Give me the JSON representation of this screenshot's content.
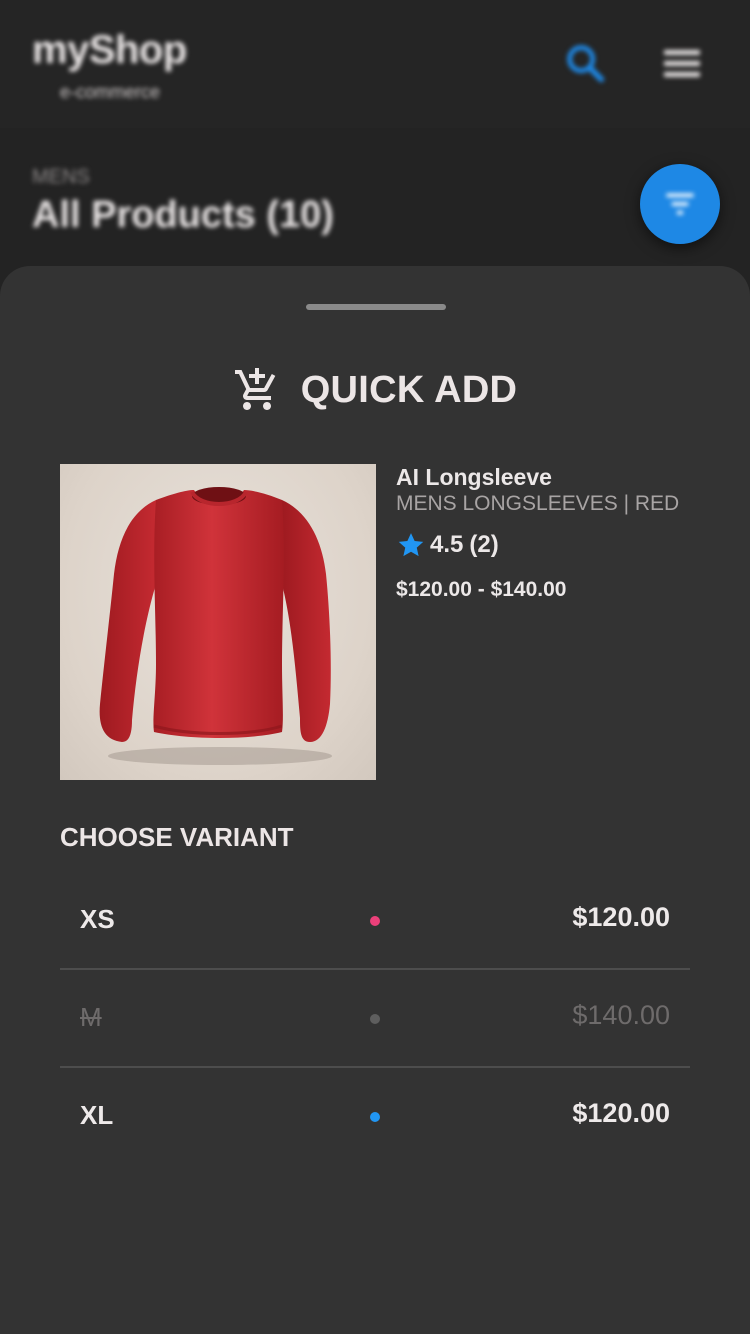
{
  "header": {
    "logo": "myShop",
    "logo_subtitle": "e-commerce",
    "search_icon": "search-icon",
    "menu_icon": "menu-icon"
  },
  "listing": {
    "category": "MENS",
    "title": "All Products (10)",
    "filter_icon": "filter-icon"
  },
  "quick_add": {
    "icon": "add-shopping-cart-icon",
    "title": "QUICK ADD",
    "product": {
      "name": "AI Longsleeve",
      "subtitle": "MENS LONGSLEEVES | RED",
      "rating": "4.5",
      "rating_count": "(2)",
      "price_range": "$120.00 - $140.00",
      "image_alt": "Red long-sleeve shirt"
    },
    "variant_heading": "CHOOSE VARIANT",
    "variants": [
      {
        "size": "XS",
        "price": "$120.00",
        "dot_color": "#ec407a",
        "available": true
      },
      {
        "size": "M",
        "price": "$140.00",
        "dot_color": "#5e5e5e",
        "available": false
      },
      {
        "size": "XL",
        "price": "$120.00",
        "dot_color": "#2196f3",
        "available": true
      }
    ]
  },
  "colors": {
    "accent": "#1e88e5",
    "sheet_background": "#333333",
    "page_background": "#232323",
    "star": "#2196f3"
  }
}
